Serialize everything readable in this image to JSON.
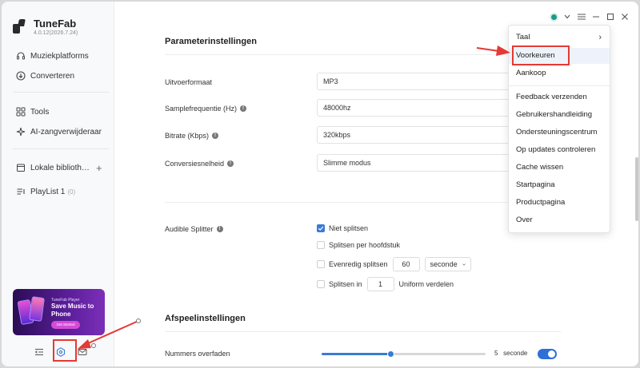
{
  "app": {
    "name": "TuneFab",
    "version": "4.0.12(2026.7.24)"
  },
  "sidebar": {
    "items": [
      {
        "label": "Muziekplatforms",
        "icon": "headphones-icon"
      },
      {
        "label": "Converteren",
        "icon": "download-circle-icon"
      },
      {
        "label": "Tools",
        "icon": "grid-icon"
      },
      {
        "label": "AI-zangverwijderaar",
        "icon": "sparkle-icon"
      },
      {
        "label": "Lokale biblioth…",
        "icon": "library-icon"
      },
      {
        "label": "PlayList 1",
        "icon": "playlist-icon",
        "count": "(0)"
      }
    ],
    "promo": {
      "small": "TuneFab Player",
      "big": "Save Music to Phone",
      "cta": "Get Started"
    }
  },
  "parameters": {
    "title": "Parameterinstellingen",
    "rows": [
      {
        "label": "Uitvoerformaat",
        "value": "MP3",
        "info": false
      },
      {
        "label": "Samplefrequentie (Hz)",
        "value": "48000hz",
        "info": true
      },
      {
        "label": "Bitrate (Kbps)",
        "value": "320kbps",
        "info": true
      },
      {
        "label": "Conversiesnelheid",
        "value": "Slimme modus",
        "info": true
      }
    ]
  },
  "splitter": {
    "label": "Audible Splitter",
    "options": {
      "none": "Niet splitsen",
      "chapter": "Splitsen per hoofdstuk",
      "even": "Evenredig splitsen",
      "even_value": "60",
      "even_unit": "seconde",
      "parts_prefix": "Splitsen in",
      "parts_value": "1",
      "parts_suffix": "Uniform verdelen"
    },
    "checked": "none"
  },
  "playback": {
    "title": "Afspeelinstellingen",
    "crossfade_label": "Nummers overfaden",
    "crossfade_value": "5",
    "crossfade_unit": "seconde",
    "slider_fraction": 0.42,
    "toggle_on": true
  },
  "menu": {
    "items": [
      {
        "label": "Taal",
        "submenu": true
      },
      {
        "label": "Voorkeuren",
        "highlighted": true
      },
      {
        "label": "Aankoop"
      },
      {
        "label": "Feedback verzenden"
      },
      {
        "label": "Gebruikershandleiding"
      },
      {
        "label": "Ondersteuningscentrum"
      },
      {
        "label": "Op updates controleren"
      },
      {
        "label": "Cache wissen"
      },
      {
        "label": "Startpagina"
      },
      {
        "label": "Productpagina"
      },
      {
        "label": "Over"
      }
    ]
  },
  "colors": {
    "accent": "#3a7bd5",
    "annotation": "#e53935",
    "promo": "#5b1e9a"
  }
}
